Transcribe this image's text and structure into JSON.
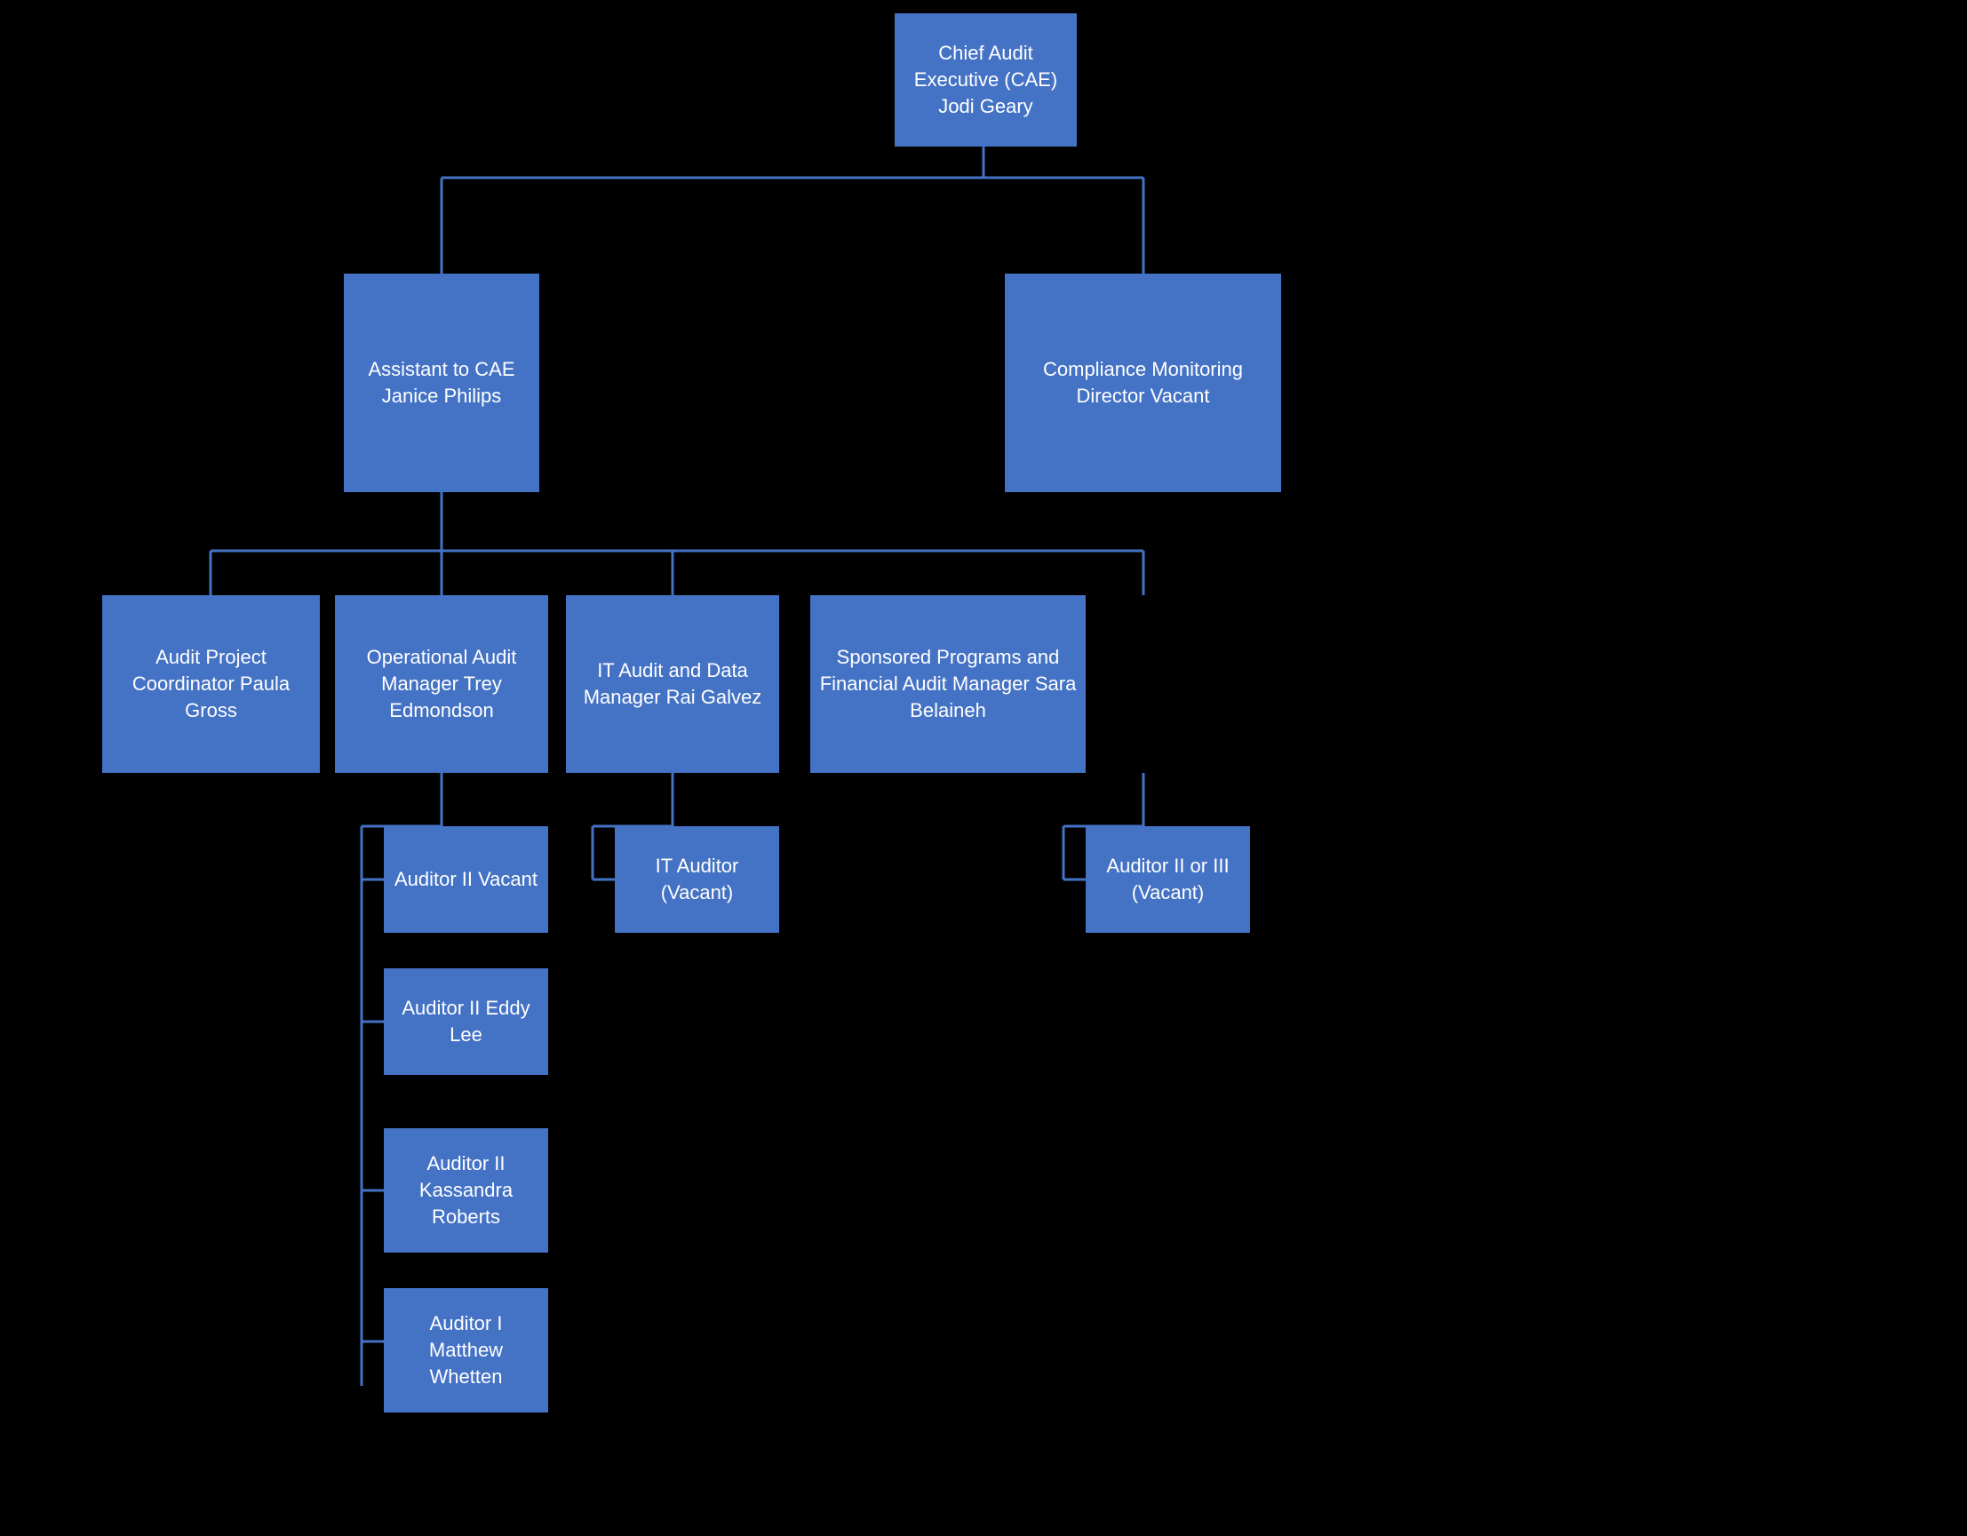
{
  "nodes": {
    "cae": {
      "title": "Chief Audit Executive (CAE) Jodi Geary",
      "line1": "Chief Audit Executive",
      "line2": "(CAE) Jodi Geary"
    },
    "assistant_cae": {
      "title": "Assistant to CAE Janice Philips",
      "line1": "Assistant to CAE",
      "line2": "Janice Philips"
    },
    "compliance_director": {
      "title": "Compliance Monitoring Director Vacant",
      "line1": "Compliance",
      "line2": "Monitoring",
      "line3": "Director",
      "line4": "",
      "line5": "Vacant"
    },
    "audit_project_coord": {
      "title": "Audit Project Coordinator Paula Gross",
      "line1": "Audit Project",
      "line2": "Coordinator",
      "line3": "",
      "line4": "Paula Gross"
    },
    "operational_audit_mgr": {
      "title": "Operational Audit Manager Trey Edmondson",
      "line1": "Operational Audit",
      "line2": "Manager",
      "line3": "Trey Edmondson"
    },
    "it_audit_mgr": {
      "title": "IT Audit and Data Manager Rai Galvez",
      "line1": "IT Audit and Data",
      "line2": "Manager",
      "line3": "Rai Galvez"
    },
    "sponsored_programs_mgr": {
      "title": "Sponsored Programs and Financial Audit Manager Sara Belaineh",
      "line1": "Sponsored Programs and",
      "line2": "Financial Audit Manager",
      "line3": "Sara Belaineh"
    },
    "auditor_ii_vacant": {
      "title": "Auditor II Vacant",
      "line1": "Auditor II",
      "line2": "Vacant"
    },
    "auditor_ii_eddy": {
      "title": "Auditor II Eddy Lee",
      "line1": "Auditor II",
      "line2": "Eddy Lee"
    },
    "auditor_ii_kassandra": {
      "title": "Auditor II Kassandra Roberts",
      "line1": "Auditor II",
      "line2": "Kassandra",
      "line3": "Roberts"
    },
    "auditor_i_matthew": {
      "title": "Auditor I Matthew Whetten",
      "line1": "Auditor I",
      "line2": "Matthew",
      "line3": "Whetten"
    },
    "it_auditor_vacant": {
      "title": "IT Auditor (Vacant)",
      "line1": "IT Auditor",
      "line2": "(Vacant)"
    },
    "auditor_ii_iii_vacant": {
      "title": "Auditor II or III (Vacant)",
      "line1": "Auditor II or III",
      "line2": "(Vacant)"
    }
  }
}
